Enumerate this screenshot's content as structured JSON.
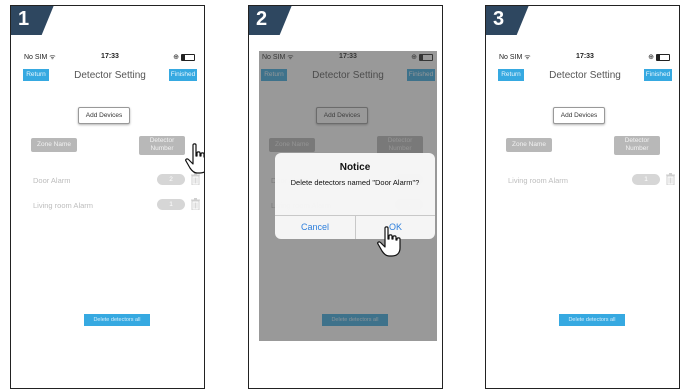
{
  "colors": {
    "accent": "#36a9e1",
    "badge": "#2e4760",
    "dialog_button": "#2d7fdc"
  },
  "status": {
    "carrier": "No SIM",
    "time": "17:33"
  },
  "nav": {
    "back_label": "Return",
    "title": "Detector Setting",
    "done_label": "Finished"
  },
  "toolbar": {
    "add_label": "Add Devices"
  },
  "table": {
    "headers": [
      "Zone Name",
      "Detector",
      "Number"
    ],
    "rows_initial": [
      {
        "name": "Door Alarm",
        "number": "2"
      },
      {
        "name": "Living room Alarm",
        "number": "1"
      }
    ],
    "rows_after": [
      {
        "name": "Living room Alarm",
        "number": "1"
      }
    ]
  },
  "footer": {
    "delete_all_label": "Delete detectors all"
  },
  "dialog": {
    "title": "Notice",
    "message": "Delete detectors named \"Door Alarm\"?",
    "cancel_label": "Cancel",
    "ok_label": "OK"
  },
  "steps": [
    "1",
    "2",
    "3"
  ],
  "icons": [
    "wifi-icon",
    "alarm-clock-icon",
    "battery-icon",
    "trash-icon",
    "hand-pointer-icon"
  ]
}
